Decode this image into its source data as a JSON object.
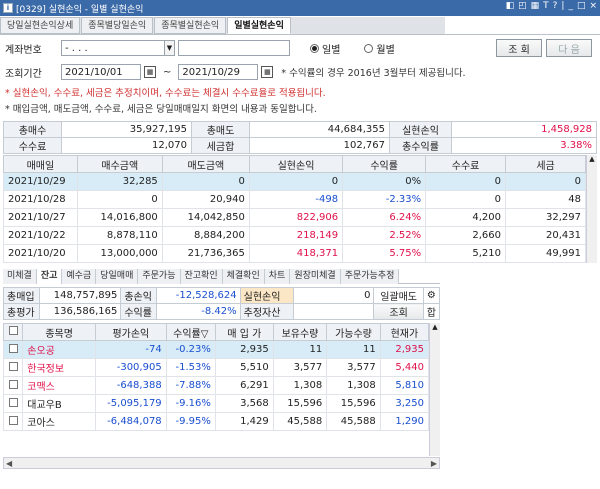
{
  "window": {
    "title": "[0329] 실현손익 - 일별 실현손익",
    "icon": "i"
  },
  "title_controls": [
    "◧",
    "◰",
    "▦",
    "T",
    "?",
    "|",
    "_",
    "□",
    "×"
  ],
  "tabs": [
    "당일실현손익상세",
    "종목별당일손익",
    "종목별실현손익",
    "일별실현손익"
  ],
  "form": {
    "account_label": "계좌번호",
    "account_value": "- . . .",
    "account_name": "",
    "radio_daily": "일별",
    "radio_monthly": "월별",
    "btn_query": "조 회",
    "btn_next": "다 음",
    "period_label": "조회기간",
    "date_from": "2021/10/01",
    "tilde": "~",
    "date_to": "2021/10/29",
    "period_note": "* 수익률의 경우 2016년 3월부터 제공됩니다.",
    "note_red": "* 실현손익, 수수료, 세금은 추정치이며, 수수료는 체결시 수수료율로 적용됩니다.",
    "note2": "* 매입금액, 매도금액, 수수료, 세금은 당일매매일지 화면의 내용과 동일합니다."
  },
  "summary": {
    "r1": {
      "l1": "총매수",
      "v1": "35,927,195",
      "l2": "총매도",
      "v2": "44,684,355",
      "l3": "실현손익",
      "v3": "1,458,928"
    },
    "r2": {
      "l1": "수수료",
      "v1": "12,070",
      "l2": "세금합",
      "v2": "102,767",
      "l3": "총수익률",
      "v3": "3.38%"
    }
  },
  "daily": {
    "headers": [
      "매매일",
      "매수금액",
      "매도금액",
      "실현손익",
      "수익률",
      "수수료",
      "세금"
    ],
    "rows": [
      {
        "date": "2021/10/29",
        "buy": "32,285",
        "sell": "0",
        "pnl": "0",
        "rate": "0%",
        "fee": "0",
        "tax": "0"
      },
      {
        "date": "2021/10/28",
        "buy": "0",
        "sell": "20,940",
        "pnl": "-498",
        "rate": "-2.33%",
        "fee": "0",
        "tax": "48"
      },
      {
        "date": "2021/10/27",
        "buy": "14,016,800",
        "sell": "14,042,850",
        "pnl": "822,906",
        "rate": "6.24%",
        "fee": "4,200",
        "tax": "32,297"
      },
      {
        "date": "2021/10/22",
        "buy": "8,878,110",
        "sell": "8,884,200",
        "pnl": "218,149",
        "rate": "2.52%",
        "fee": "2,660",
        "tax": "20,431"
      },
      {
        "date": "2021/10/20",
        "buy": "13,000,000",
        "sell": "21,736,365",
        "pnl": "418,371",
        "rate": "5.75%",
        "fee": "5,210",
        "tax": "49,991"
      }
    ]
  },
  "tabs2": [
    "미체결",
    "잔고",
    "예수금",
    "당일매매",
    "주문가능",
    "잔고확인",
    "체결확인",
    "차트",
    "원장미체결",
    "주문가능추정"
  ],
  "balance": {
    "l_buy": "총매입",
    "v_buy": "148,757,895",
    "l_pnl": "총손익",
    "v_pnl": "-12,528,624",
    "l_real": "실현손익",
    "v_real": "0",
    "btn_batch": "일괄매도",
    "l_eval": "총평가",
    "v_eval": "136,586,165",
    "l_rate": "수익률",
    "v_rate": "-8.42%",
    "l_est": "추정자산",
    "v_est": "",
    "btn_query": "조회",
    "btn_sum": "합"
  },
  "holdings": {
    "headers": [
      "종목명",
      "평가손익",
      "수익률▽",
      "매 입 가",
      "보유수량",
      "가능수량",
      "현재가"
    ],
    "rows": [
      {
        "name": "손오공",
        "pnl": "-74",
        "rate": "-0.23%",
        "avg": "2,935",
        "qty": "11",
        "avail": "11",
        "price": "2,935"
      },
      {
        "name": "한국정보",
        "pnl": "-300,905",
        "rate": "-1.53%",
        "avg": "5,510",
        "qty": "3,577",
        "avail": "3,577",
        "price": "5,440"
      },
      {
        "name": "코맥스",
        "pnl": "-648,388",
        "rate": "-7.88%",
        "avg": "6,291",
        "qty": "1,308",
        "avail": "1,308",
        "price": "5,810"
      },
      {
        "name": "대교우B",
        "pnl": "-5,095,179",
        "rate": "-9.16%",
        "avg": "3,568",
        "qty": "15,596",
        "avail": "15,596",
        "price": "3,250"
      },
      {
        "name": "코아스",
        "pnl": "-6,484,078",
        "rate": "-9.95%",
        "avg": "1,429",
        "qty": "45,588",
        "avail": "45,588",
        "price": "1,290"
      }
    ]
  },
  "colors": {
    "title": "#3b6aa8",
    "selected_row": "#d7ecf7",
    "loss": "#1a4fd0",
    "gain": "#e0104a"
  }
}
